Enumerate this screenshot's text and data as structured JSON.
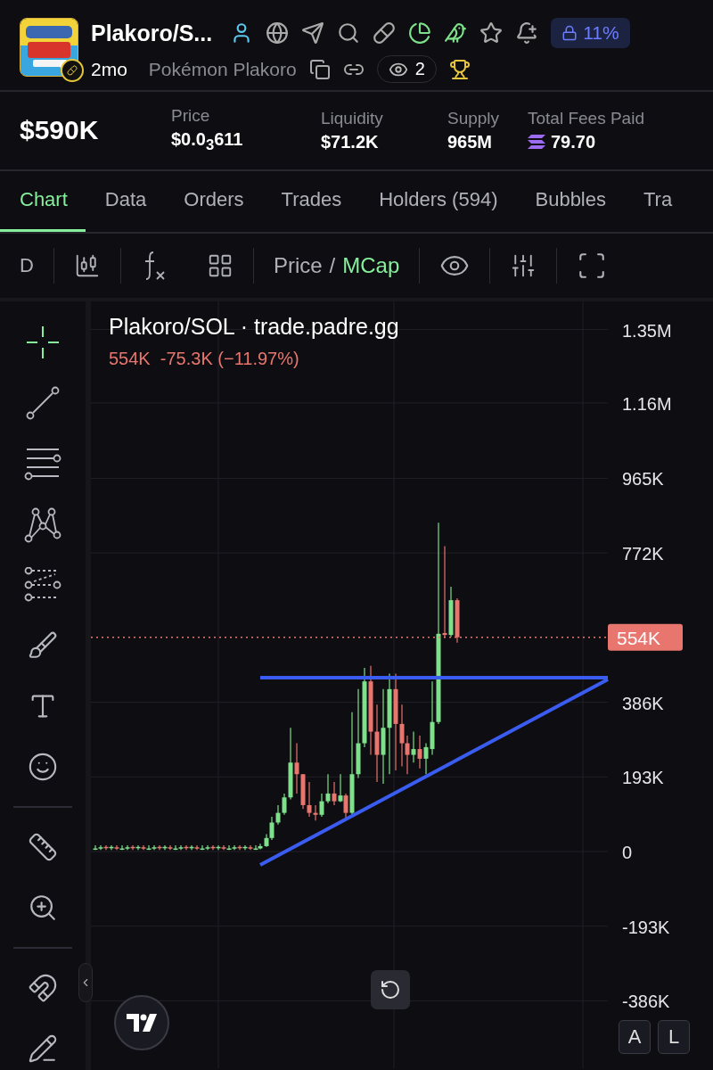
{
  "token": {
    "name": "Plakoro/S...",
    "age": "2mo",
    "full_name": "Pokémon Plakoro",
    "watchers": "2",
    "lock_percent": "11%"
  },
  "stats": {
    "market_cap": "$590K",
    "items": [
      {
        "label": "Price",
        "value": "$0.0$_{3}$611",
        "kind": "plain"
      },
      {
        "label": "Liquidity",
        "value": "$71.2K",
        "kind": "plain"
      },
      {
        "label": "Supply",
        "value": "965M",
        "kind": "plain"
      },
      {
        "label": "Total Fees Paid",
        "value": "79.70",
        "kind": "sol"
      }
    ]
  },
  "tabs": [
    {
      "label": "Chart",
      "selected": true
    },
    {
      "label": "Data",
      "selected": false
    },
    {
      "label": "Orders",
      "selected": false
    },
    {
      "label": "Trades",
      "selected": false
    },
    {
      "label": "Holders",
      "count": "(594)",
      "selected": false
    },
    {
      "label": "Bubbles",
      "selected": false
    },
    {
      "label": "Tra",
      "selected": false
    }
  ],
  "toolbar": {
    "interval": "D",
    "separator": "/",
    "modes": [
      {
        "label": "Price",
        "selected": false
      },
      {
        "label": "MCap",
        "selected": true
      }
    ]
  },
  "tools": [
    [
      {
        "kind": "crosshair",
        "selected": true
      },
      {
        "kind": "line",
        "selected": false
      },
      {
        "kind": "levels",
        "selected": false
      },
      {
        "kind": "pattern",
        "selected": false
      },
      {
        "kind": "fib",
        "selected": false
      },
      {
        "kind": "brush",
        "selected": false
      },
      {
        "kind": "text",
        "selected": false
      },
      {
        "kind": "emoji",
        "selected": false
      }
    ],
    [
      {
        "kind": "ruler",
        "selected": false
      },
      {
        "kind": "zoom",
        "selected": false
      }
    ],
    [
      {
        "kind": "magnet",
        "selected": false
      },
      {
        "kind": "lock",
        "selected": false
      }
    ]
  ],
  "chart": {
    "title": "Plakoro/SOL · trade.padre.gg",
    "change": "554K  -75.3K (−11.97%)",
    "y_labels": [
      "1.35M",
      "1.16M",
      "965K",
      "772K",
      "386K",
      "193K",
      "0",
      "-193K",
      "-386K"
    ],
    "price_tag": "554K",
    "scale_buttons": [
      "A",
      "L"
    ]
  }
}
